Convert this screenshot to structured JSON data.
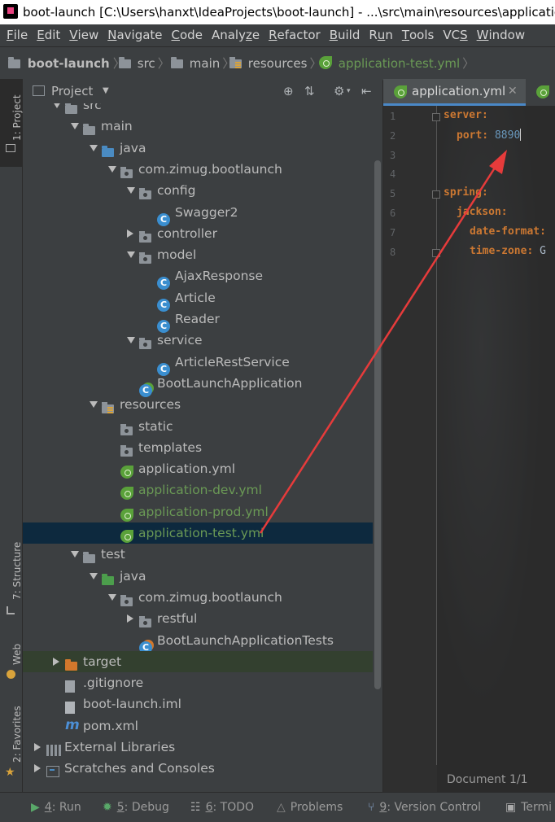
{
  "window": {
    "title": "boot-launch [C:\\Users\\hanxt\\IdeaProjects\\boot-launch] - ...\\src\\main\\resources\\application-test.yml [boot-launch] - IntelliJ IDEA"
  },
  "menu": {
    "items": [
      "File",
      "Edit",
      "View",
      "Navigate",
      "Code",
      "Analyze",
      "Refactor",
      "Build",
      "Run",
      "Tools",
      "VCS",
      "Window"
    ],
    "accel": [
      "F",
      "E",
      "V",
      "N",
      "C",
      "z",
      "R",
      "B",
      "u",
      "T",
      "S",
      "W"
    ]
  },
  "breadcrumb": [
    "boot-launch",
    "src",
    "main",
    "resources",
    "application-test.yml"
  ],
  "left_strip": {
    "project": "1: Project",
    "structure": "7: Structure",
    "web": "Web",
    "favorites": "2: Favorites"
  },
  "project_panel": {
    "title": "Project",
    "tree": [
      {
        "label": "src",
        "icon": "folder-icon",
        "depth": 1,
        "arrow": "down"
      },
      {
        "label": "main",
        "icon": "folder-icon",
        "depth": 2,
        "arrow": "down"
      },
      {
        "label": "java",
        "icon": "source-folder-icon",
        "depth": 3,
        "arrow": "down"
      },
      {
        "label": "com.zimug.bootlaunch",
        "icon": "package-icon",
        "depth": 4,
        "arrow": "down"
      },
      {
        "label": "config",
        "icon": "package-icon",
        "depth": 5,
        "arrow": "down"
      },
      {
        "label": "Swagger2",
        "icon": "class-icon",
        "depth": 6,
        "arrow": "none"
      },
      {
        "label": "controller",
        "icon": "package-icon",
        "depth": 5,
        "arrow": "right"
      },
      {
        "label": "model",
        "icon": "package-icon",
        "depth": 5,
        "arrow": "down"
      },
      {
        "label": "AjaxResponse",
        "icon": "class-icon",
        "depth": 6,
        "arrow": "none"
      },
      {
        "label": "Article",
        "icon": "class-icon",
        "depth": 6,
        "arrow": "none"
      },
      {
        "label": "Reader",
        "icon": "class-icon",
        "depth": 6,
        "arrow": "none"
      },
      {
        "label": "service",
        "icon": "package-icon",
        "depth": 5,
        "arrow": "down"
      },
      {
        "label": "ArticleRestService",
        "icon": "class-icon",
        "depth": 6,
        "arrow": "none"
      },
      {
        "label": "BootLaunchApplication",
        "icon": "spring-class-icon",
        "depth": 5,
        "arrow": "none"
      },
      {
        "label": "resources",
        "icon": "resources-folder-icon",
        "depth": 3,
        "arrow": "down"
      },
      {
        "label": "static",
        "icon": "package-icon",
        "depth": 4,
        "arrow": "none"
      },
      {
        "label": "templates",
        "icon": "package-icon",
        "depth": 4,
        "arrow": "none"
      },
      {
        "label": "application.yml",
        "icon": "spring-yml-icon",
        "depth": 4,
        "arrow": "none"
      },
      {
        "label": "application-dev.yml",
        "icon": "spring-yml-icon",
        "depth": 4,
        "arrow": "none",
        "style": "new"
      },
      {
        "label": "application-prod.yml",
        "icon": "spring-yml-icon",
        "depth": 4,
        "arrow": "none",
        "style": "new"
      },
      {
        "label": "application-test.yml",
        "icon": "spring-yml-icon",
        "depth": 4,
        "arrow": "none",
        "style": "new",
        "selected": true
      },
      {
        "label": "test",
        "icon": "folder-icon",
        "depth": 2,
        "arrow": "down"
      },
      {
        "label": "java",
        "icon": "test-source-folder-icon",
        "depth": 3,
        "arrow": "down"
      },
      {
        "label": "com.zimug.bootlaunch",
        "icon": "package-icon",
        "depth": 4,
        "arrow": "down"
      },
      {
        "label": "restful",
        "icon": "package-icon",
        "depth": 5,
        "arrow": "right"
      },
      {
        "label": "BootLaunchApplicationTests",
        "icon": "spring-test-class-icon",
        "depth": 5,
        "arrow": "none"
      },
      {
        "label": "target",
        "icon": "excluded-folder-icon",
        "depth": 1,
        "arrow": "right",
        "style": "excluded"
      },
      {
        "label": ".gitignore",
        "icon": "file-icon",
        "depth": 1,
        "arrow": "none"
      },
      {
        "label": "boot-launch.iml",
        "icon": "iml-file-icon",
        "depth": 1,
        "arrow": "none"
      },
      {
        "label": "pom.xml",
        "icon": "maven-icon",
        "depth": 1,
        "arrow": "none"
      },
      {
        "label": "External Libraries",
        "icon": "libraries-icon",
        "depth": 0,
        "arrow": "right"
      },
      {
        "label": "Scratches and Consoles",
        "icon": "scratches-icon",
        "depth": 0,
        "arrow": "right"
      }
    ]
  },
  "editor": {
    "tab_label": "application.yml",
    "line_numbers": [
      "1",
      "2",
      "3",
      "4",
      "5",
      "6",
      "7",
      "8"
    ],
    "lines": [
      {
        "key": "server:",
        "value": "",
        "indent": 0
      },
      {
        "key": "port: ",
        "value": "8890",
        "indent": 1
      },
      {
        "key": "",
        "value": "",
        "indent": 0
      },
      {
        "key": "",
        "value": "",
        "indent": 0
      },
      {
        "key": "spring:",
        "value": "",
        "indent": 0
      },
      {
        "key": "jackson:",
        "value": "",
        "indent": 1
      },
      {
        "key": "date-format:",
        "value": "",
        "indent": 2
      },
      {
        "key": "time-zone: ",
        "value": "G",
        "indent": 2
      }
    ],
    "status": "Document 1/1"
  },
  "bottom_tools": [
    {
      "accel": "4",
      "label": ": Run",
      "icon": "run-icon"
    },
    {
      "accel": "5",
      "label": ": Debug",
      "icon": "debug-icon"
    },
    {
      "accel": "6",
      "label": ": TODO",
      "icon": "todo-icon"
    },
    {
      "accel": "",
      "label": "Problems",
      "icon": "problems-icon"
    },
    {
      "accel": "9",
      "label": ": Version Control",
      "icon": "vcs-icon"
    },
    {
      "accel": "",
      "label": "Termi",
      "icon": "terminal-icon"
    }
  ],
  "colors": {
    "selected_row": "#0d293e",
    "new_file_text": "#6a9955",
    "annotation_arrow": "#e63b3b",
    "yaml_key": "#cc7832",
    "yaml_number": "#6897bb"
  }
}
